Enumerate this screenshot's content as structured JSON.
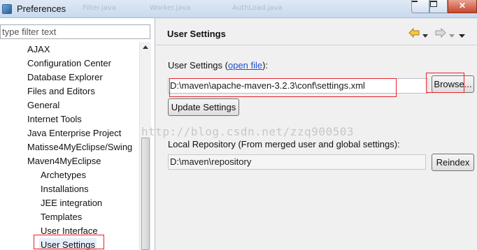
{
  "window": {
    "title": "Preferences",
    "background_tabs": [
      "Filter.java",
      "Worker.java",
      "AuthLoad.java"
    ]
  },
  "filter": {
    "placeholder": "type filter text"
  },
  "tree": {
    "items": [
      {
        "label": "AJAX",
        "level": 1
      },
      {
        "label": "Configuration Center",
        "level": 1
      },
      {
        "label": "Database Explorer",
        "level": 1
      },
      {
        "label": "Files and Editors",
        "level": 1
      },
      {
        "label": "General",
        "level": 1
      },
      {
        "label": "Internet Tools",
        "level": 1
      },
      {
        "label": "Java Enterprise Project",
        "level": 1
      },
      {
        "label": "Matisse4MyEclipse/Swing",
        "level": 1
      },
      {
        "label": "Maven4MyEclipse",
        "level": 1
      },
      {
        "label": "Archetypes",
        "level": 2
      },
      {
        "label": "Installations",
        "level": 2
      },
      {
        "label": "JEE integration",
        "level": 2
      },
      {
        "label": "Templates",
        "level": 2
      },
      {
        "label": "User Interface",
        "level": 2
      },
      {
        "label": "User Settings",
        "level": 2,
        "selected": true
      }
    ]
  },
  "page": {
    "title": "User Settings",
    "user_settings_label": "User Settings (",
    "open_file_link": "open file",
    "user_settings_label_end": "):",
    "settings_path": "D:\\maven\\apache-maven-3.2.3\\conf\\settings.xml",
    "browse_button": "Browse...",
    "update_button": "Update Settings",
    "local_repo_label": "Local Repository (From merged user and global settings):",
    "local_repo_path": "D:\\maven\\repository",
    "reindex_button": "Reindex"
  },
  "watermark": "http://blog.csdn.net/zzq900503",
  "colors": {
    "highlight_box": "#e8212b",
    "link": "#1f4fd0"
  },
  "icons": [
    "preferences-window-icon",
    "minimize-icon",
    "maximize-icon",
    "close-icon",
    "back-arrow-icon",
    "forward-arrow-icon",
    "view-menu-icon"
  ]
}
